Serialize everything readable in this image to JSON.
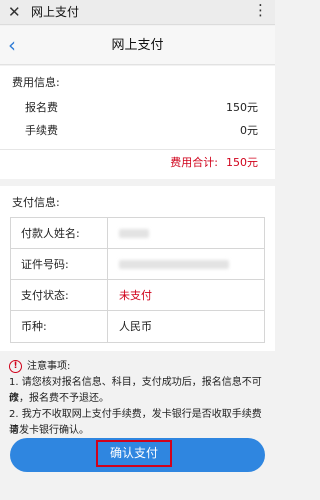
{
  "topbar": {
    "close_glyph": "✕",
    "title": "网上支付",
    "more_glyph": "⋮"
  },
  "navbar": {
    "back_glyph": "‹",
    "title": "网上支付"
  },
  "fee_info": {
    "heading": "费用信息:",
    "items": [
      {
        "label": "报名费",
        "value": "150元"
      },
      {
        "label": "手续费",
        "value": "0元"
      }
    ],
    "total_label": "费用合计:",
    "total_value": "150元"
  },
  "payment_info": {
    "heading": "支付信息:",
    "rows": [
      {
        "key": "付款人姓名:",
        "value": ""
      },
      {
        "key": "证件号码:",
        "value": ""
      },
      {
        "key": "支付状态:",
        "value": "未支付"
      },
      {
        "key": "币种:",
        "value": "人民币"
      }
    ]
  },
  "notice": {
    "title": "注意事项:",
    "items": [
      "1. 请您核对报名信息、科目，支付成功后，报名信息不可修",
      "改，报名费不予退还。",
      "2. 我方不收取网上支付手续费，发卡银行是否收取手续费请",
      "与发卡银行确认。"
    ]
  },
  "confirm_button": {
    "label": "确认支付"
  },
  "colors": {
    "accent": "#2f86e0",
    "warning": "#d0021b"
  }
}
